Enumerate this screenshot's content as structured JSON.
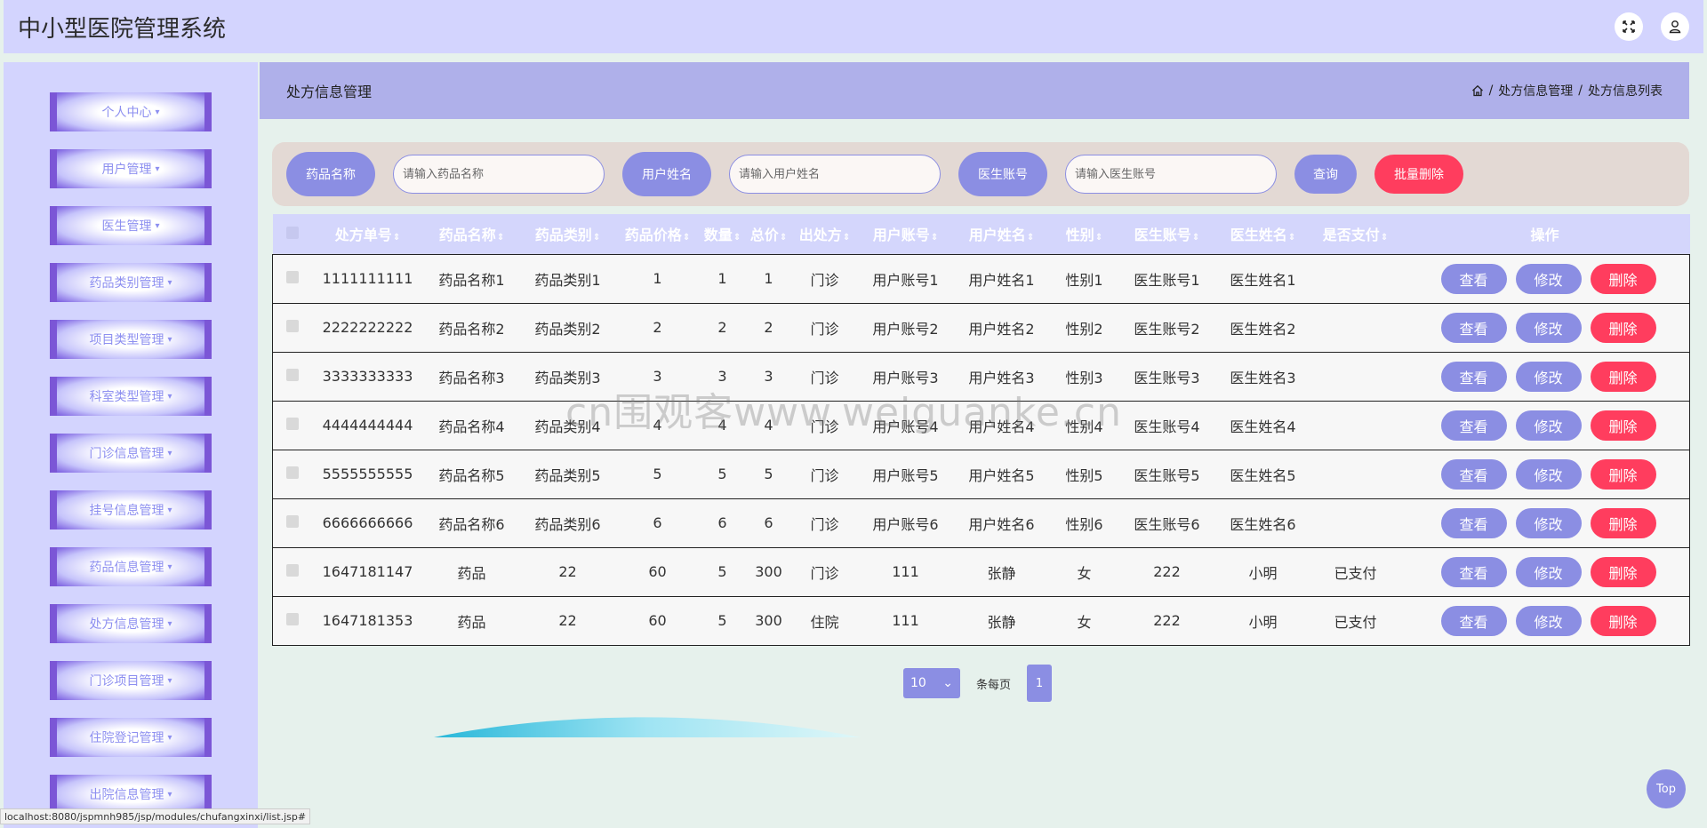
{
  "app": {
    "title": "中小型医院管理系统"
  },
  "sidebar": {
    "items": [
      {
        "label": "个人中心"
      },
      {
        "label": "用户管理"
      },
      {
        "label": "医生管理"
      },
      {
        "label": "药品类别管理"
      },
      {
        "label": "项目类型管理"
      },
      {
        "label": "科室类型管理"
      },
      {
        "label": "门诊信息管理"
      },
      {
        "label": "挂号信息管理"
      },
      {
        "label": "药品信息管理"
      },
      {
        "label": "处方信息管理"
      },
      {
        "label": "门诊项目管理"
      },
      {
        "label": "住院登记管理"
      },
      {
        "label": "出院信息管理"
      }
    ],
    "caret": "▾"
  },
  "header": {
    "title": "处方信息管理",
    "breadcrumb": [
      "处方信息管理",
      "处方信息列表"
    ],
    "separator": "/"
  },
  "search": {
    "drug_label": "药品名称",
    "drug_placeholder": "请输入药品名称",
    "user_label": "用户姓名",
    "user_placeholder": "请输入用户姓名",
    "doctor_label": "医生账号",
    "doctor_placeholder": "请输入医生账号",
    "query_label": "查询",
    "batch_delete_label": "批量删除"
  },
  "table": {
    "columns": [
      "处方单号",
      "药品名称",
      "药品类别",
      "药品价格",
      "数量",
      "总价",
      "出处方",
      "用户账号",
      "用户姓名",
      "性别",
      "医生账号",
      "医生姓名",
      "是否支付",
      "操作"
    ],
    "rows": [
      [
        "1111111111",
        "药品名称1",
        "药品类别1",
        "1",
        "1",
        "1",
        "门诊",
        "用户账号1",
        "用户姓名1",
        "性别1",
        "医生账号1",
        "医生姓名1",
        ""
      ],
      [
        "2222222222",
        "药品名称2",
        "药品类别2",
        "2",
        "2",
        "2",
        "门诊",
        "用户账号2",
        "用户姓名2",
        "性别2",
        "医生账号2",
        "医生姓名2",
        ""
      ],
      [
        "3333333333",
        "药品名称3",
        "药品类别3",
        "3",
        "3",
        "3",
        "门诊",
        "用户账号3",
        "用户姓名3",
        "性别3",
        "医生账号3",
        "医生姓名3",
        ""
      ],
      [
        "4444444444",
        "药品名称4",
        "药品类别4",
        "4",
        "4",
        "4",
        "门诊",
        "用户账号4",
        "用户姓名4",
        "性别4",
        "医生账号4",
        "医生姓名4",
        ""
      ],
      [
        "5555555555",
        "药品名称5",
        "药品类别5",
        "5",
        "5",
        "5",
        "门诊",
        "用户账号5",
        "用户姓名5",
        "性别5",
        "医生账号5",
        "医生姓名5",
        ""
      ],
      [
        "6666666666",
        "药品名称6",
        "药品类别6",
        "6",
        "6",
        "6",
        "门诊",
        "用户账号6",
        "用户姓名6",
        "性别6",
        "医生账号6",
        "医生姓名6",
        ""
      ],
      [
        "1647181147",
        "药品",
        "22",
        "60",
        "5",
        "300",
        "门诊",
        "111",
        "张静",
        "女",
        "222",
        "小明",
        "已支付"
      ],
      [
        "1647181353",
        "药品",
        "22",
        "60",
        "5",
        "300",
        "住院",
        "111",
        "张静",
        "女",
        "222",
        "小明",
        "已支付"
      ]
    ],
    "actions": {
      "view": "查看",
      "edit": "修改",
      "delete": "删除"
    },
    "sort_glyph": "⇕"
  },
  "pager": {
    "page_size": "10",
    "per_page_label": "条每页",
    "current_page": "1"
  },
  "status_url": "localhost:8080/jspmnh985/jsp/modules/chufangxinxi/list.jsp#",
  "top_button": "Top",
  "watermark": "cn围观客www.weiguanke.cn",
  "colors": {
    "accent": "#8b8ee3",
    "danger": "#ff3d5e",
    "topbar": "#d3d4fe",
    "header": "#afb0ea"
  },
  "icons": {
    "fullscreen": "fullscreen-icon",
    "user": "user-icon",
    "home": "home-icon"
  }
}
